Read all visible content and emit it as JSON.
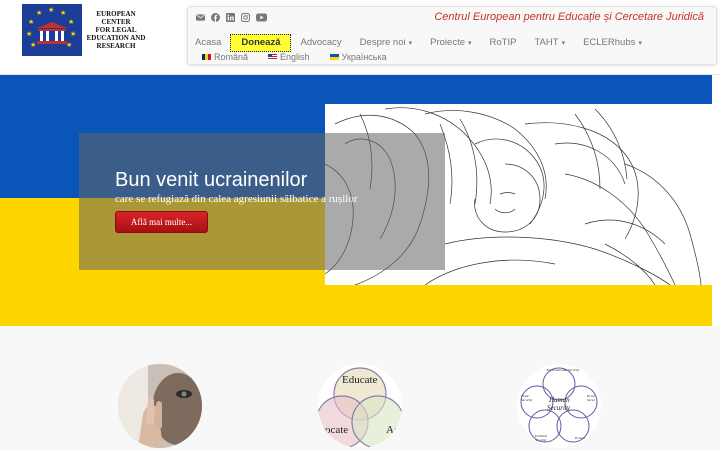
{
  "logo": {
    "line1": "European Center",
    "line2": "for Legal",
    "line3": "Education and",
    "line4": "Research"
  },
  "social_icons": [
    "email-icon",
    "facebook-icon",
    "linkedin-icon",
    "instagram-icon",
    "youtube-icon"
  ],
  "tagline": "Centrul European pentru Educație și Cercetare Juridică",
  "menu": {
    "acasa": "Acasa",
    "doneaza": "Donează",
    "advocacy": "Advocacy",
    "despre": "Despre noi",
    "proiecte": "Proiecte",
    "rotip": "RoTIP",
    "taht": "TAHT",
    "eclerhubs": "ECLERhubs",
    "caret": "▾"
  },
  "languages": {
    "ro": "Română",
    "en": "English",
    "ua": "Українська"
  },
  "hero": {
    "title": "Bun venit ucrainenilor",
    "subtitle": "care se refugiază din calea agresiunii sălbatice a rușilor",
    "button": "Află mai multe..."
  },
  "features": {
    "educate_circle": {
      "top": "Educate",
      "left": "Advocate",
      "right": "Act"
    },
    "security_circle": {
      "center1": "Human",
      "center2": "Security",
      "top": "Environmental Security",
      "left": "Food Security",
      "right": "Perso Secur",
      "bottom_left": "Political Security",
      "bottom_right": "Econor"
    }
  },
  "colors": {
    "ukraine_blue": "#0a55b8",
    "ukraine_yellow": "#ffd500",
    "tagline_red": "#c4312c",
    "donate_yellow": "#ffff33",
    "button_red": "#c01a1f"
  }
}
